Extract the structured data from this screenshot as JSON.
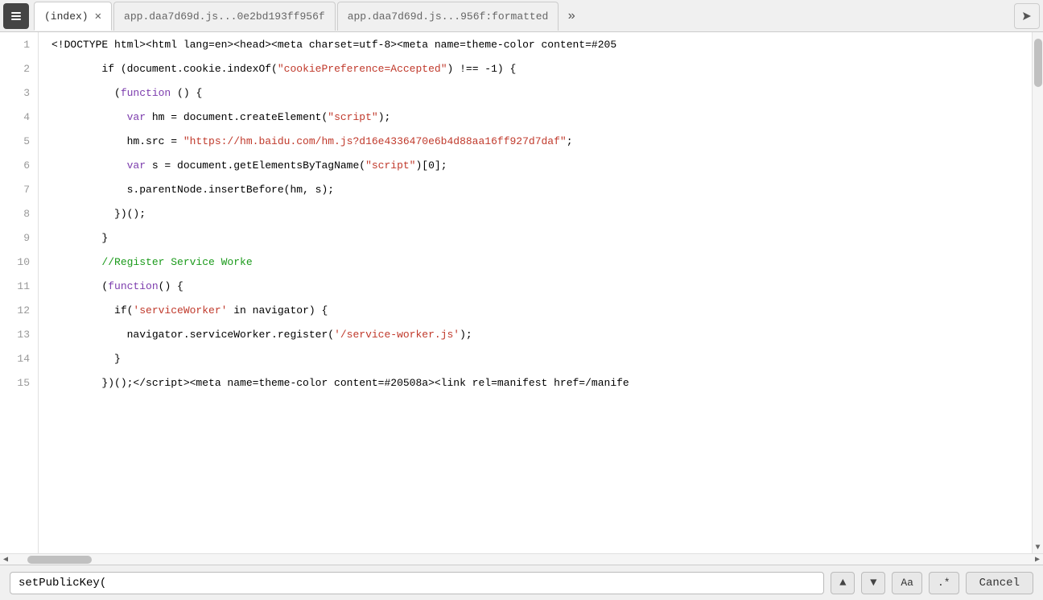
{
  "tabs": [
    {
      "id": "back-btn",
      "label": "←",
      "type": "back"
    },
    {
      "id": "index",
      "label": "(index)",
      "active": true,
      "closeable": true
    },
    {
      "id": "app1",
      "label": "app.daa7d69d.js...0e2bd193ff956f",
      "active": false,
      "closeable": false
    },
    {
      "id": "app2",
      "label": "app.daa7d69d.js...956f:formatted",
      "active": false,
      "closeable": false
    },
    {
      "id": "overflow",
      "label": "»",
      "type": "overflow"
    },
    {
      "id": "forward",
      "label": "↗",
      "type": "forward"
    }
  ],
  "code_lines": [
    {
      "num": 1,
      "tokens": [
        {
          "text": "<!DOCTYPE html><html lang=en><head><meta charset=utf-8><meta name=theme-color content=#205",
          "color": "black"
        }
      ]
    },
    {
      "num": 2,
      "tokens": [
        {
          "text": "        if (document.cookie.indexOf(",
          "color": "black"
        },
        {
          "text": "\"cookiePreference=Accepted\"",
          "color": "string"
        },
        {
          "text": ") !== -1) {",
          "color": "black"
        }
      ]
    },
    {
      "num": 3,
      "tokens": [
        {
          "text": "          (",
          "color": "black"
        },
        {
          "text": "function",
          "color": "purple"
        },
        {
          "text": " () {",
          "color": "black"
        }
      ]
    },
    {
      "num": 4,
      "tokens": [
        {
          "text": "            ",
          "color": "black"
        },
        {
          "text": "var",
          "color": "purple"
        },
        {
          "text": " hm = document.createElement(",
          "color": "black"
        },
        {
          "text": "\"script\"",
          "color": "string"
        },
        {
          "text": ");",
          "color": "black"
        }
      ]
    },
    {
      "num": 5,
      "tokens": [
        {
          "text": "            hm.src = ",
          "color": "black"
        },
        {
          "text": "\"https://hm.baidu.com/hm.js?d16e4336470e6b4d88aa16ff927d7daf\"",
          "color": "string"
        },
        {
          "text": ";",
          "color": "black"
        }
      ]
    },
    {
      "num": 6,
      "tokens": [
        {
          "text": "            ",
          "color": "black"
        },
        {
          "text": "var",
          "color": "purple"
        },
        {
          "text": " s = document.getElementsByTagName(",
          "color": "black"
        },
        {
          "text": "\"script\"",
          "color": "string"
        },
        {
          "text": ")[0];",
          "color": "black"
        }
      ]
    },
    {
      "num": 7,
      "tokens": [
        {
          "text": "            s.parentNode.insertBefore(hm, s);",
          "color": "black"
        }
      ]
    },
    {
      "num": 8,
      "tokens": [
        {
          "text": "          })();",
          "color": "black"
        }
      ]
    },
    {
      "num": 9,
      "tokens": [
        {
          "text": "        }",
          "color": "black"
        }
      ]
    },
    {
      "num": 10,
      "tokens": [
        {
          "text": "        //Register Service Worke",
          "color": "comment"
        }
      ]
    },
    {
      "num": 11,
      "tokens": [
        {
          "text": "        (",
          "color": "black"
        },
        {
          "text": "function",
          "color": "purple"
        },
        {
          "text": "() {",
          "color": "black"
        }
      ]
    },
    {
      "num": 12,
      "tokens": [
        {
          "text": "          if(",
          "color": "black"
        },
        {
          "text": "'serviceWorker'",
          "color": "string"
        },
        {
          "text": " in navigator) {",
          "color": "black"
        }
      ]
    },
    {
      "num": 13,
      "tokens": [
        {
          "text": "            navigator.serviceWorker.register(",
          "color": "black"
        },
        {
          "text": "'/service-worker.js'",
          "color": "string"
        },
        {
          "text": ");",
          "color": "black"
        }
      ]
    },
    {
      "num": 14,
      "tokens": [
        {
          "text": "          }",
          "color": "black"
        }
      ]
    },
    {
      "num": 15,
      "tokens": [
        {
          "text": "        })();</",
          "color": "black"
        },
        {
          "text": "script",
          "color": "black"
        },
        {
          "text": "><meta name=theme-color content=#20508a><link rel=manifest href=/manife",
          "color": "black"
        }
      ]
    }
  ],
  "find_bar": {
    "input_value": "setPublicKey(",
    "input_placeholder": "",
    "match_case_label": "Aa",
    "regex_label": ".*",
    "cancel_label": "Cancel"
  }
}
